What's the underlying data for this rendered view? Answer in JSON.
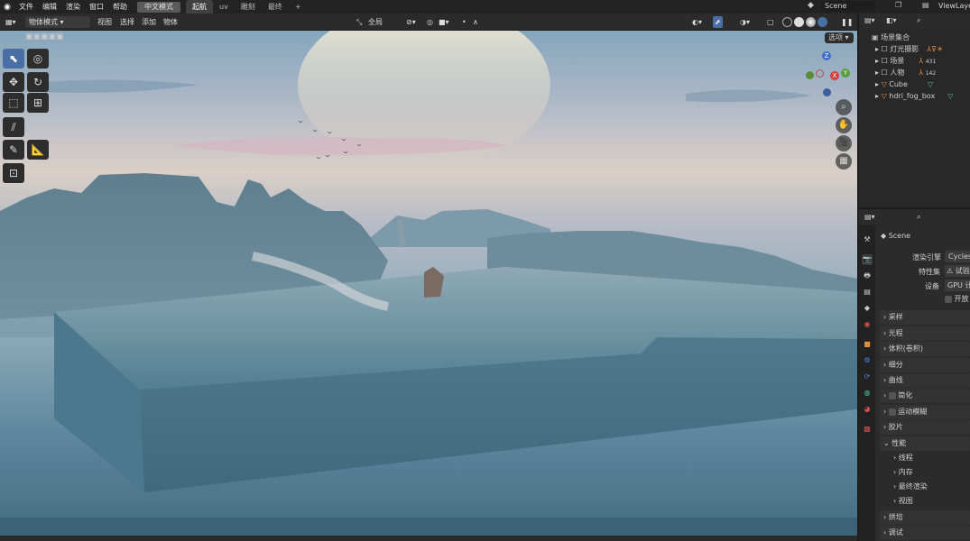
{
  "menu": {
    "file": "文件",
    "edit": "编辑",
    "render": "渲染",
    "window": "窗口",
    "help": "帮助",
    "lang": "中文模式"
  },
  "workspaces": [
    "起航",
    "uv",
    "雕刻",
    "最终"
  ],
  "scene_name": "Scene",
  "view_layer": "ViewLaye",
  "viewport_header": {
    "mode": "物体模式",
    "view": "视图",
    "select": "选择",
    "add": "添加",
    "object": "物体",
    "transform": "全局"
  },
  "options_label": "选项",
  "gizmo": {
    "z": "Z",
    "x": "X",
    "y": "Y"
  },
  "outliner": {
    "collection": "场景集合",
    "items": [
      {
        "label": "灯光摄影"
      },
      {
        "label": "场景",
        "count": "431"
      },
      {
        "label": "人物",
        "count": "142"
      },
      {
        "label": "Cube"
      },
      {
        "label": "hdri_fog_box"
      }
    ]
  },
  "properties": {
    "scene": "Scene",
    "render_engine_label": "渲染引擎",
    "render_engine_value": "Cycles",
    "feature_set_label": "特性集",
    "feature_set_value": "试验",
    "device_label": "设备",
    "device_value": "GPU 计",
    "open_label": "开放",
    "panels": [
      {
        "label": "采样"
      },
      {
        "label": "光程"
      },
      {
        "label": "体积(卷积)"
      },
      {
        "label": "细分"
      },
      {
        "label": "曲线"
      },
      {
        "label": "简化"
      },
      {
        "label": "运动模糊"
      },
      {
        "label": "胶片"
      },
      {
        "label": "性能"
      }
    ],
    "perf_sub": [
      "线程",
      "内存",
      "最终渲染",
      "视图"
    ],
    "panels2": [
      {
        "label": "烘培"
      },
      {
        "label": "调试"
      }
    ]
  },
  "colors": {
    "accent": "#4a6fa5",
    "header": "#2b2b2b",
    "panel": "#282828"
  }
}
